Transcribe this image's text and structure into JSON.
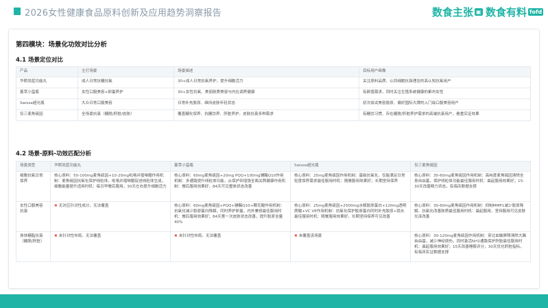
{
  "header": {
    "title": "2026女性健康食品原料创新及应用趋势洞察报告",
    "brand1": "数食主张",
    "brand1_tag": "",
    "brand2": "数食有料",
    "brand2_tag": "fofd"
  },
  "module_title": "第四模块：场景化功效对比分析",
  "section1": {
    "title": "4.1 场景定位对比",
    "headers": [
      "产品",
      "主打场景",
      "场景描述",
      "目标用户画像"
    ],
    "rows": [
      [
        "华熙尚蓝功能丸",
        "成人日常抗糖抗氧",
        "30+成人日常抗氧养护，提升细胞活力",
        "关注原料品质、认同细胞抗衰理念的高认知抗氧用户"
      ],
      [
        "姜萃小蛮瓶",
        "女性口服美容+卵巢养护",
        "30+女性抗氧、美丽肤质美容与内在调养健康",
        "有颜值需求，同时关注生殖系统健康的都市女性"
      ],
      [
        "Swisse超光瓶",
        "大众日常口服美容",
        "日常补充胶原、维持皮肤年轻状态",
        "初次尝试美容胶原、偏好国际大牌的入门级口服美容用户"
      ],
      [
        "仅三麦角硫因",
        "全场景抗衰（糖脱/肝脏/皮肤）",
        "覆盖糖化保养、抗糖饮养、肝脏养护、皮肤抗衰多种需求",
        "有糖饮习惯、存在糖脱/肝脏养护需求的高端抗衰用户，看重实证效果"
      ]
    ]
  },
  "section2": {
    "title": "4.2 场景-原料-功效匹配分析",
    "headers": [
      "场景类型",
      "华熙尚蓝功能丸",
      "姜萃小蛮瓶",
      "Swisse超光瓶",
      "仅三麦角硫因"
    ],
    "rows": [
      {
        "label": "细胞抗氧日常保养",
        "cells": [
          {
            "x": false,
            "text": "核心原料：50-100mg麦角硫因+10-20mg吡咯并喹啉醌作用机制：麦角硫因抗氧化保护线粒体，吡咯并喹啉醌促进线粒体生成，细胞能量提升适用时机：每日早餐后服用，30天左右提升细胞活力"
          },
          {
            "x": false,
            "text": "核心原料：60mg麦角硫因+20mg PQQ+100mg辅酶Q10作用机制：多通路提升线粒体功能，从保护到增强全面关照健康作用机制：餐后服用效果好，84天可见整体状态改善"
          },
          {
            "x": false,
            "text": "核心原料：25mg麦角硫因作用机制：基础抗氧化，仅能满足日常轻度保养需求最佳服用时机：随餐服用效果好；长期坚持保养"
          },
          {
            "x": false,
            "text": "核心原料：30-60mg麦角硫因作用机制：高纯度麦角硫因清除全身自由基，保护线粒体功能最佳服用时机：晨起服用效果好；15-30天改善精力状态，有临床数据支撑"
          }
        ]
      },
      {
        "label": "女性口服美容抗衰",
        "cells": [
          {
            "x": true,
            "text": "无对应针对性成分，无法覆盖"
          },
          {
            "x": false,
            "text": "核心原料：60mg麦角硫因+PQQ+辅酶Q10+鞣花酸作用机制：抗氧化减少胶原蛋白降解，同时养护卵巢，内外兼修最佳服用时机：餐后服用效果好；84天第一次皮肤状态改善，提升胶原含量40%"
          },
          {
            "x": false,
            "text": "核心原料：25mg麦角硫因+2500mg水解胶原蛋白+120mg透明质酸+VC VE作用机制：抗氧化保护胶原蛋白同时补充胶原+锁水最佳服用时机：随餐服用效果好，长期坚持保养可见改善"
          },
          {
            "x": false,
            "text": "核心原料：30-60mg麦角硫因作用机制：抑制MMP1减少胶原降解、抗氧化改善肤质最佳服用时机：晨起服用，坚持服用可见皮肤光泽改善"
          }
        ]
      },
      {
        "label": "身体糖脂抗衰（糖脱/肝脏）",
        "cells": [
          {
            "x": true,
            "text": "未针对性布局，无法覆盖"
          },
          {
            "x": true,
            "text": "未针对性布局，无法覆盖"
          },
          {
            "x": true,
            "text": "未覆盖该场景"
          },
          {
            "x": false,
            "text": "核心原料：30-120mg麦角硫因作用机制：穿过血脑屏障清除大脑自由基，减少神经损伤，同时激活Nrf2通路保护肝脏最佳服用时机：晨起服用效果好；15天改善睡眠评分，30天优化肝脏指标，有临床实证数据支撑"
          }
        ]
      }
    ]
  }
}
